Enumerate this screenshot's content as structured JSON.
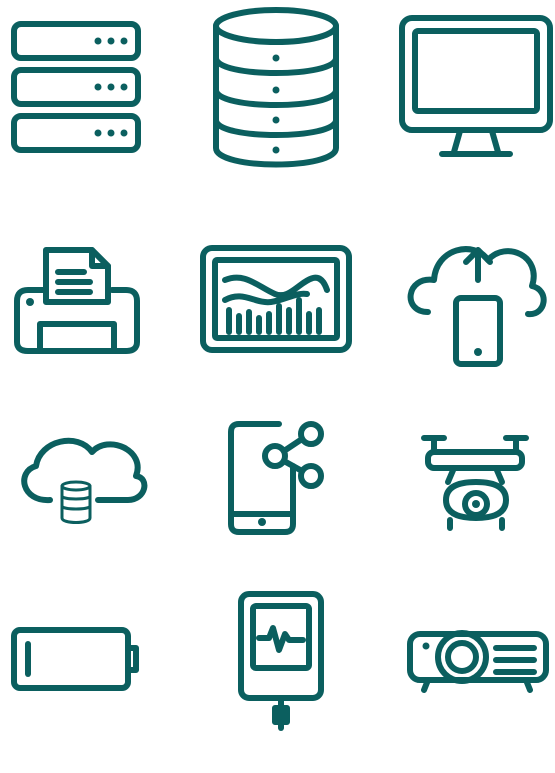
{
  "theme": {
    "icon_color": "#0b5f5f",
    "background": "#ffffff"
  },
  "icons": [
    {
      "name": "server-rack-icon"
    },
    {
      "name": "database-icon"
    },
    {
      "name": "desktop-monitor-icon"
    },
    {
      "name": "printer-icon"
    },
    {
      "name": "analytics-tablet-icon"
    },
    {
      "name": "cloud-upload-mobile-icon"
    },
    {
      "name": "cloud-database-icon"
    },
    {
      "name": "mobile-share-icon"
    },
    {
      "name": "drone-camera-icon"
    },
    {
      "name": "battery-low-icon"
    },
    {
      "name": "glucose-meter-icon"
    },
    {
      "name": "projector-icon"
    }
  ]
}
